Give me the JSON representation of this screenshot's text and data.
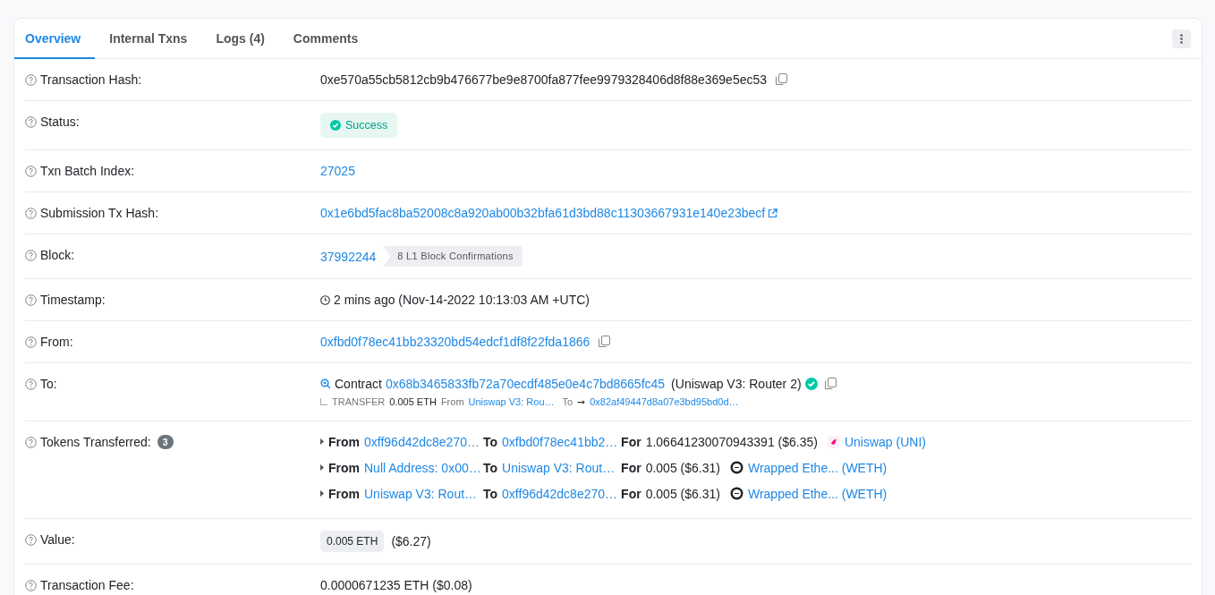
{
  "tabs": [
    {
      "label": "Overview",
      "selected": true
    },
    {
      "label": "Internal Txns",
      "selected": false
    },
    {
      "label": "Logs (4)",
      "selected": false
    },
    {
      "label": "Comments",
      "selected": false
    }
  ],
  "rows": [
    {
      "label": "Transaction Hash:",
      "kind": "copy",
      "value": "0xe570a55cb5812cb9b476677be9e8700fa877fee9979328406d8f88e369e5ec53"
    },
    {
      "label": "Status:",
      "kind": "status",
      "value": "Success"
    },
    {
      "label": "Txn Batch Index:",
      "kind": "link",
      "value": "27025"
    },
    {
      "label": "Submission Tx Hash:",
      "kind": "external",
      "value": "0x1e6bd5fac8ba52008c8a920ab00b32bfa61d3bd88c11303667931e140e23becf"
    },
    {
      "label": "Block:",
      "kind": "block",
      "value": "37992244",
      "tag": "8 L1 Block Confirmations"
    },
    {
      "label": "Timestamp:",
      "kind": "timestamp",
      "value": "2 mins ago (Nov-14-2022 10:13:03 AM +UTC)"
    },
    {
      "label": "From:",
      "kind": "copy-link",
      "value": "0xfbd0f78ec41bb23320bd54edcf1df8f22fda1866"
    },
    {
      "label": "To:",
      "kind": "to",
      "prefix": "Contract",
      "value": "0x68b3465833fb72a70ecdf485e0e4c7bd8665fc45",
      "name": "(Uniswap V3: Router 2)",
      "verified": true,
      "transfer": {
        "type": "TRANSFER",
        "amount": "0.005 ETH",
        "from_label": "From",
        "from": "Uniswap V3: Rou…",
        "to_label": "To",
        "arrow": "➞",
        "to": "0x82af49447d8a07e3bd95bd0d…"
      }
    },
    {
      "label": "Tokens Transferred:",
      "kind": "tokens",
      "count": "3",
      "transfers": [
        {
          "from_label": "From",
          "from": "0xff96d42dc8e270…",
          "to_label": "To",
          "to": "0xfbd0f78ec41bb2…",
          "for_label": "For",
          "amount": "1.06641230070943391 ($6.35)",
          "token": "Uniswap (UNI)",
          "kind": "uni"
        },
        {
          "from_label": "From",
          "from": "Null Address: 0x00…",
          "to_label": "To",
          "to": "Uniswap V3: Rout…",
          "for_label": "For",
          "amount": "0.005 ($6.31)",
          "token": "Wrapped Ethe... (WETH)",
          "kind": "weth"
        },
        {
          "from_label": "From",
          "from": "Uniswap V3: Rout…",
          "to_label": "To",
          "to": "0xff96d42dc8e270…",
          "for_label": "For",
          "amount": "0.005 ($6.31)",
          "token": "Wrapped Ethe... (WETH)",
          "kind": "weth"
        }
      ]
    },
    {
      "label": "Value:",
      "kind": "value",
      "value": "0.005 ETH",
      "usd": "($6.27)"
    },
    {
      "label": "Transaction Fee:",
      "kind": "text",
      "value": "0.0000671235 ETH ($0.08)"
    }
  ]
}
